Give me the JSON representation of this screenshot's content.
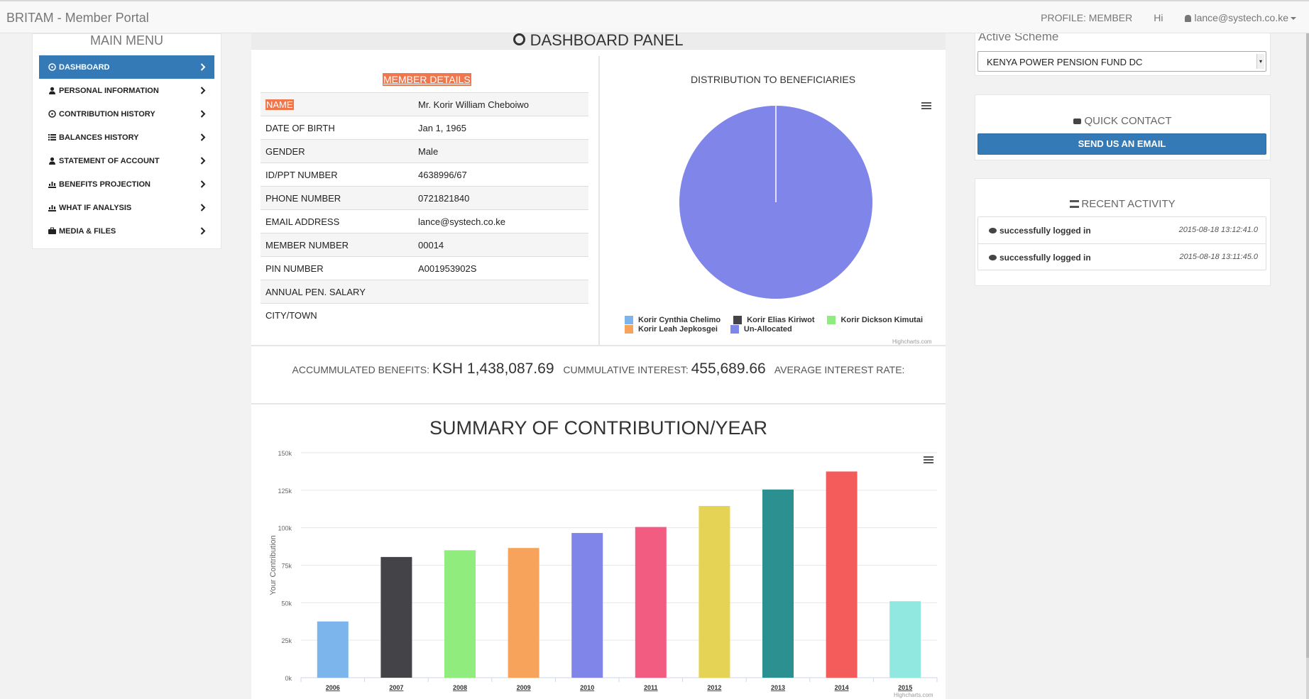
{
  "navbar": {
    "brand": "BRITAM - Member Portal",
    "profile": "PROFILE: MEMBER",
    "greeting": "Hi",
    "user": "lance@systech.co.ke"
  },
  "sidebar": {
    "title": "MAIN MENU",
    "items": [
      {
        "label": "DASHBOARD",
        "icon": "dashboard-icon",
        "active": true
      },
      {
        "label": "PERSONAL INFORMATION",
        "icon": "user-icon"
      },
      {
        "label": "CONTRIBUTION HISTORY",
        "icon": "dashboard-icon"
      },
      {
        "label": "BALANCES HISTORY",
        "icon": "list-icon"
      },
      {
        "label": "STATEMENT OF ACCOUNT",
        "icon": "user-icon"
      },
      {
        "label": "BENEFITS PROJECTION",
        "icon": "bar-chart-icon"
      },
      {
        "label": "WHAT IF ANALYSIS",
        "icon": "bar-chart-icon"
      },
      {
        "label": "MEDIA & FILES",
        "icon": "briefcase-icon"
      }
    ]
  },
  "panel": {
    "title": "DASHBOARD PANEL"
  },
  "member_details": {
    "title": "MEMBER DETAILS",
    "rows": [
      {
        "key": "NAME",
        "value": "Mr. Korir William Cheboiwo"
      },
      {
        "key": "DATE OF BIRTH",
        "value": "Jan 1, 1965"
      },
      {
        "key": "GENDER",
        "value": "Male"
      },
      {
        "key": "ID/PPT NUMBER",
        "value": "4638996/67"
      },
      {
        "key": "PHONE NUMBER",
        "value": "0721821840"
      },
      {
        "key": "EMAIL ADDRESS",
        "value": "lance@systech.co.ke"
      },
      {
        "key": "MEMBER NUMBER",
        "value": "00014"
      },
      {
        "key": "PIN NUMBER",
        "value": "A001953902S"
      },
      {
        "key": "ANNUAL PEN. SALARY",
        "value": ""
      },
      {
        "key": "CITY/TOWN",
        "value": ""
      }
    ]
  },
  "summary": {
    "accumulated_label": "ACCUMMULATED BENEFITS:",
    "accumulated_value": "KSH 1,438,087.69",
    "interest_label": "CUMMULATIVE INTEREST:",
    "interest_value": "455,689.66",
    "rate_label": "AVERAGE INTEREST RATE:"
  },
  "right": {
    "scheme_label": "Active Scheme",
    "scheme_value": "KENYA POWER PENSION FUND DC",
    "quick_contact_title": "QUICK CONTACT",
    "send_email": "SEND US AN EMAIL",
    "recent_activity_title": "RECENT ACTIVITY",
    "activities": [
      {
        "message": "successfully logged in",
        "time": "2015-08-18 13:12:41.0"
      },
      {
        "message": "successfully logged in",
        "time": "2015-08-18 13:11:45.0"
      }
    ]
  },
  "credits": "Highcharts.com",
  "chart_data": [
    {
      "type": "pie",
      "title": "DISTRIBUTION TO BENEFICIARIES",
      "series": [
        {
          "name": "Korir Cynthia Chelimo",
          "value": 0,
          "color": "#7cb5ec"
        },
        {
          "name": "Korir Elias Kiriwot",
          "value": 0,
          "color": "#434348"
        },
        {
          "name": "Korir Dickson Kimutai",
          "value": 0,
          "color": "#90ed7d"
        },
        {
          "name": "Korir Leah Jepkosgei",
          "value": 0,
          "color": "#f7a35c"
        },
        {
          "name": "Un-Allocated",
          "value": 100,
          "color": "#8085e9"
        }
      ],
      "legend": "bottom"
    },
    {
      "type": "bar",
      "title": "SUMMARY OF CONTRIBUTION/YEAR",
      "ylabel": "Your Contribution",
      "xlabel": "",
      "categories": [
        "2006",
        "2007",
        "2008",
        "2009",
        "2010",
        "2011",
        "2012",
        "2013",
        "2014",
        "2015"
      ],
      "values": [
        37500,
        80500,
        85000,
        86500,
        96500,
        100500,
        114500,
        125500,
        137500,
        51000
      ],
      "colors": [
        "#7cb5ec",
        "#434348",
        "#90ed7d",
        "#f7a35c",
        "#8085e9",
        "#f15c80",
        "#e4d354",
        "#2b908f",
        "#f45b5b",
        "#91e8e1"
      ],
      "ylim": [
        0,
        150000
      ],
      "yticks": [
        "0k",
        "25k",
        "50k",
        "75k",
        "100k",
        "125k",
        "150k"
      ],
      "grid": true
    }
  ]
}
